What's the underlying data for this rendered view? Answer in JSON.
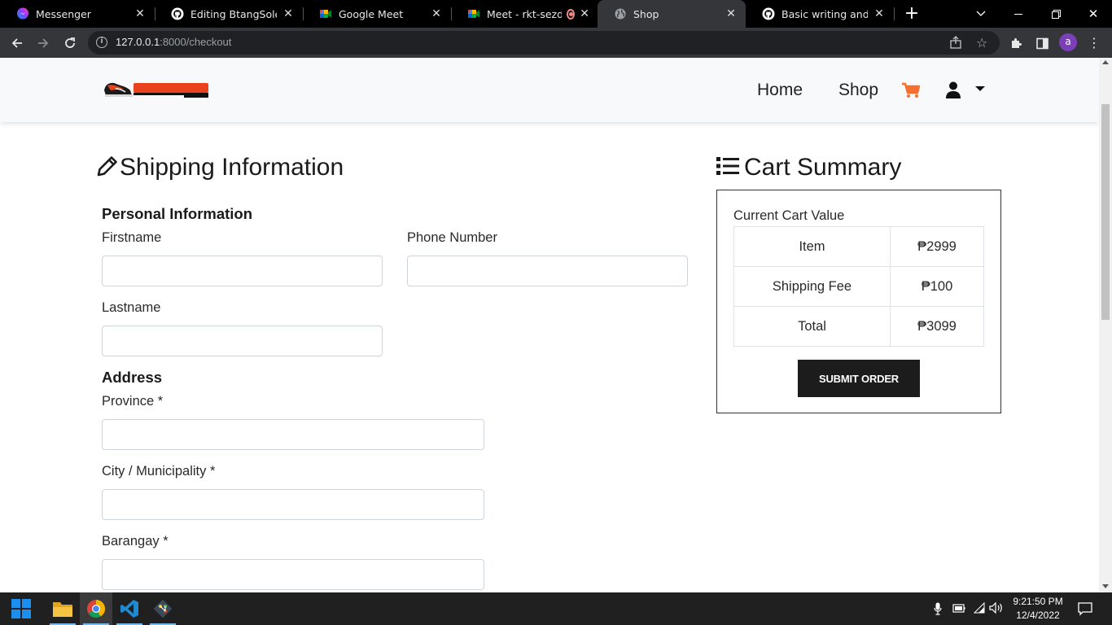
{
  "browser": {
    "tabs": [
      {
        "title": "Messenger",
        "icon": "messenger-icon"
      },
      {
        "title": "Editing BtangSole-E-C",
        "icon": "github-icon"
      },
      {
        "title": "Google Meet",
        "icon": "google-meet-icon"
      },
      {
        "title": "Meet - rkt-sezd-d",
        "icon": "google-meet-icon",
        "recording": true
      },
      {
        "title": "Shop",
        "icon": "globe-icon",
        "active": true
      },
      {
        "title": "Basic writing and form",
        "icon": "github-icon"
      }
    ],
    "url_host": "127.0.0.1",
    "url_rest": ":8000/checkout",
    "profile_initial": "a"
  },
  "navbar": {
    "home_label": "Home",
    "shop_label": "Shop",
    "cart_color": "#f46f30"
  },
  "shipping": {
    "title": "Shipping Information",
    "personal_heading": "Personal Information",
    "firstname_label": "Firstname",
    "phone_label": "Phone Number",
    "lastname_label": "Lastname",
    "address_heading": "Address",
    "province_label": "Province *",
    "city_label": "City / Municipality *",
    "barangay_label": "Barangay *",
    "firstname_value": "",
    "phone_value": "",
    "lastname_value": "",
    "province_value": "",
    "city_value": "",
    "barangay_value": ""
  },
  "cart": {
    "title": "Cart Summary",
    "caption": "Current Cart Value",
    "rows": [
      {
        "label": "Item",
        "value": "₱2999"
      },
      {
        "label": "Shipping Fee",
        "value": "₱100"
      },
      {
        "label": "Total",
        "value": "₱3099"
      }
    ],
    "submit_label": "SUBMIT ORDER"
  },
  "taskbar": {
    "time": "9:21:50 PM",
    "date": "12/4/2022"
  }
}
